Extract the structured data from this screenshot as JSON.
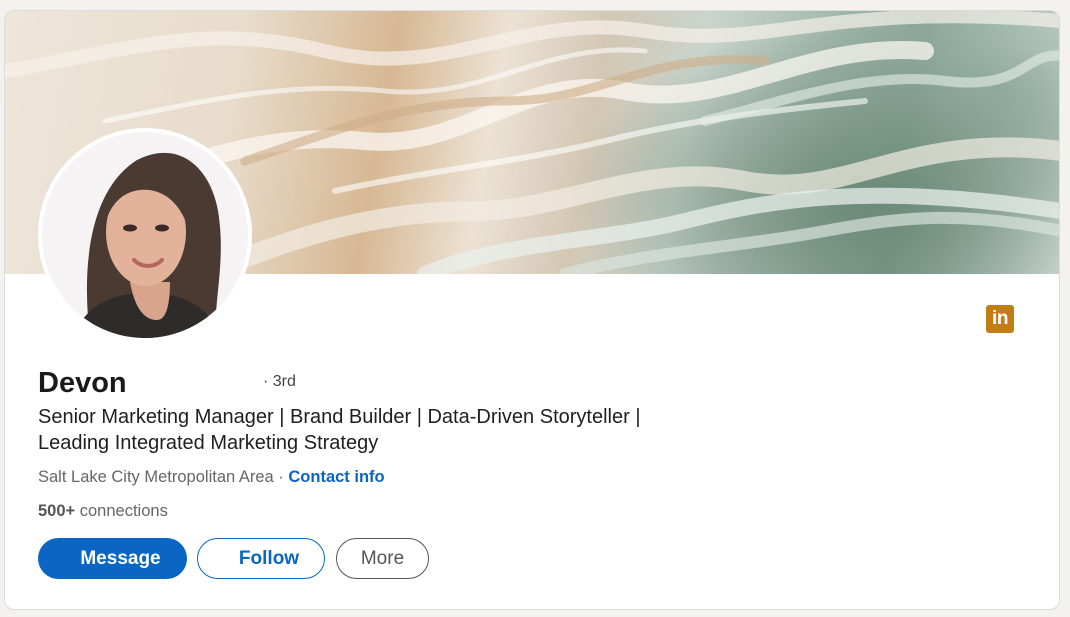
{
  "profile": {
    "name": "Devon",
    "degree": "· 3rd",
    "headline": "Senior Marketing Manager | Brand Builder | Data-Driven Storyteller | Leading Integrated Marketing Strategy",
    "location": "Salt Lake City Metropolitan Area",
    "location_separator": " · ",
    "contact_info_label": "Contact info",
    "connections_count": "500+",
    "connections_label": " connections"
  },
  "actions": {
    "message_label": "Message",
    "follow_label": "Follow",
    "more_label": "More"
  },
  "icons": {
    "brand": "linkedin-icon",
    "brand_text": "in"
  },
  "colors": {
    "accent": "#0a66c2",
    "linkedin_badge": "#c37d16"
  }
}
